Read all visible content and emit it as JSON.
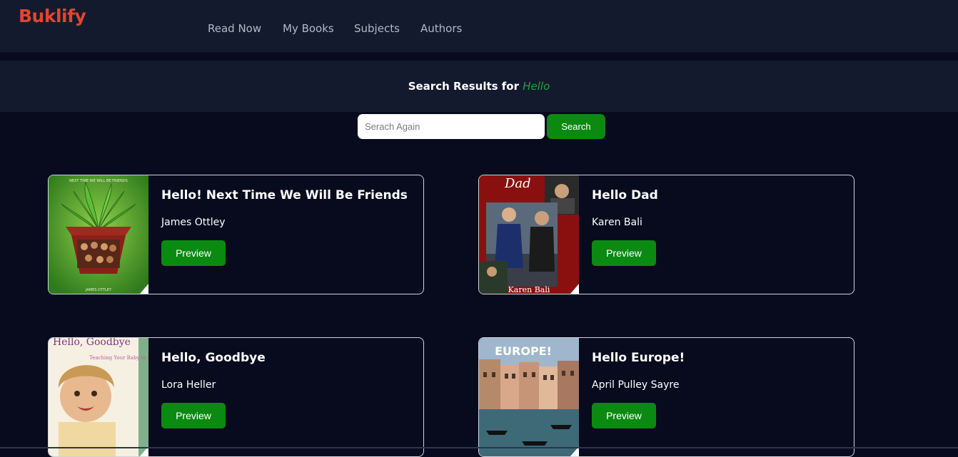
{
  "brand": "Buklify",
  "nav": {
    "items": [
      "Read Now",
      "My Books",
      "Subjects",
      "Authors"
    ]
  },
  "results": {
    "prefix": "Search Results for",
    "query": "Hello"
  },
  "search": {
    "placeholder": "Serach Again",
    "value": "",
    "button": "Search"
  },
  "books": [
    {
      "title": "Hello! Next Time We Will Be Friends",
      "author": "James Ottley",
      "button": "Preview",
      "cover_text": "NEXT TIME WE WILL BE FRIENDS",
      "cover_subtext": "JAMES OTTLEY"
    },
    {
      "title": "Hello Dad",
      "author": "Karen Bali",
      "button": "Preview",
      "cover_text": "Dad",
      "cover_subtext": "Karen Bali"
    },
    {
      "title": "Hello, Goodbye",
      "author": "Lora Heller",
      "button": "Preview",
      "cover_text": "Hello, Goodbye",
      "cover_subtext": "Teaching Your Baby to Sign"
    },
    {
      "title": "Hello Europe!",
      "author": "April Pulley Sayre",
      "button": "Preview",
      "cover_text": "EUROPE!",
      "cover_subtext": ""
    }
  ],
  "colors": {
    "background": "#070b1d",
    "navbar": "#131a2e",
    "brand": "#e0462f",
    "accent_green": "#0b8a12",
    "query_green": "#22a33a"
  }
}
